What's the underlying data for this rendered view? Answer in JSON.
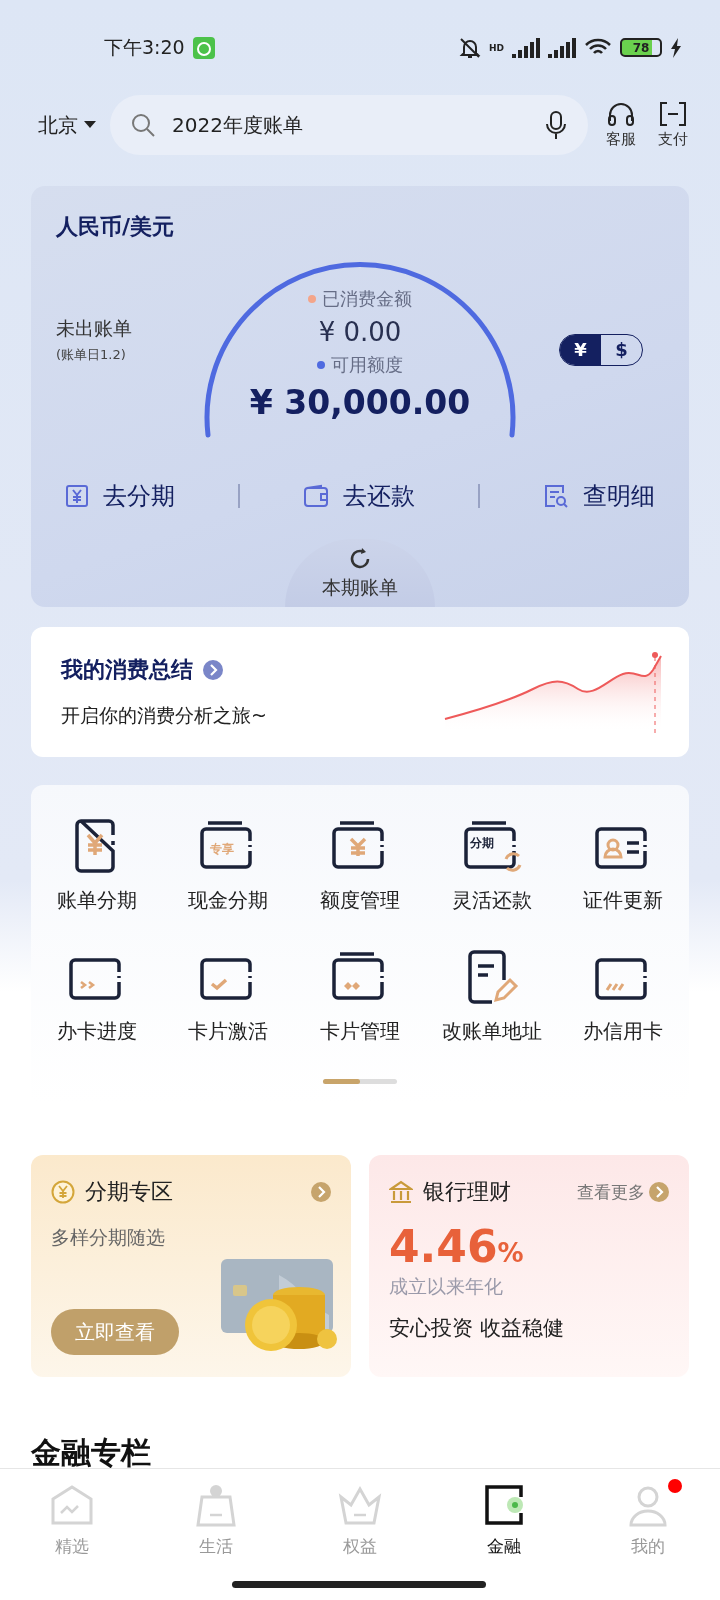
{
  "status_bar": {
    "time": "下午3:20",
    "network": "HD",
    "battery": "78"
  },
  "header": {
    "city": "北京",
    "search": {
      "value": "2022年度账单"
    },
    "actions": [
      {
        "kind": "headset",
        "label": "客服"
      },
      {
        "kind": "scan",
        "label": "支付"
      }
    ]
  },
  "bill_card": {
    "title": "人民币/美元",
    "status": "未出账单",
    "bill_day": "(账单日1.2)",
    "currency_toggle": [
      {
        "label": "¥",
        "selected": true
      },
      {
        "label": "$",
        "selected": false
      }
    ],
    "spent": {
      "label": "已消费金额",
      "amount": "¥ 0.00",
      "color": "#f4a58a"
    },
    "available": {
      "label": "可用额度",
      "amount": "¥ 30,000.00",
      "color": "#4f6ae0"
    },
    "actions": [
      {
        "kind": "installment",
        "label": "去分期"
      },
      {
        "kind": "repay",
        "label": "去还款"
      },
      {
        "kind": "details",
        "label": "查明细"
      }
    ],
    "tab": "本期账单"
  },
  "summary": {
    "title": "我的消费总结",
    "subtitle": "开启你的消费分析之旅~"
  },
  "services": [
    {
      "kind": "yuan-doc",
      "label": "账单分期"
    },
    {
      "kind": "text-card",
      "icon_text": "专享",
      "label": "现金分期"
    },
    {
      "kind": "yuan-card",
      "label": "额度管理"
    },
    {
      "kind": "refresh-card",
      "icon_text": "分期",
      "label": "灵活还款"
    },
    {
      "kind": "id-card",
      "label": "证件更新"
    },
    {
      "kind": "progress-card",
      "label": "办卡进度"
    },
    {
      "kind": "check-card",
      "label": "卡片激活"
    },
    {
      "kind": "diamond-card",
      "label": "卡片管理"
    },
    {
      "kind": "edit-doc",
      "label": "改账单地址"
    },
    {
      "kind": "slash-card",
      "label": "办信用卡"
    }
  ],
  "promos": [
    {
      "kind": "installment",
      "title": "分期专区",
      "subtitle": "多样分期随选",
      "button": "立即查看"
    },
    {
      "kind": "wealth",
      "title": "银行理财",
      "more": "查看更多",
      "rate": "4.46",
      "unit": "%",
      "rate_label": "成立以来年化",
      "slogan": "安心投资 收益稳健"
    }
  ],
  "section_title": "金融专栏",
  "nav": [
    {
      "kind": "home",
      "label": "精选",
      "selected": false,
      "badge": false
    },
    {
      "kind": "bag",
      "label": "生活",
      "selected": false,
      "badge": false
    },
    {
      "kind": "crown",
      "label": "权益",
      "selected": false,
      "badge": false
    },
    {
      "kind": "wallet",
      "label": "金融",
      "selected": true,
      "badge": false
    },
    {
      "kind": "user",
      "label": "我的",
      "selected": false,
      "badge": true
    }
  ]
}
